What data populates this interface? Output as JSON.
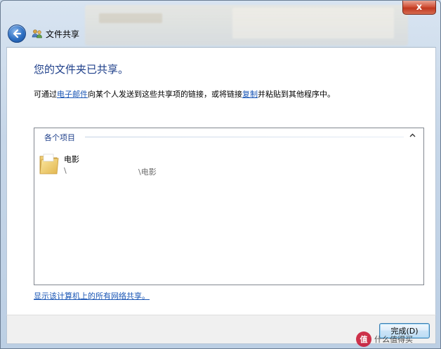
{
  "window": {
    "title": "文件共享",
    "close_glyph": "x"
  },
  "main": {
    "heading": "您的文件夹已共享。",
    "desc_before": "可通过",
    "desc_link_email": "电子邮件",
    "desc_middle": "向某个人发送到这些共享项的链接，或将链接",
    "desc_link_copy": "复制",
    "desc_after": "并粘贴到其他程序中。",
    "group_header": "各个项目",
    "items": [
      {
        "name": "电影",
        "path_prefix": "\\",
        "path_suffix": "\\电影"
      }
    ],
    "show_all_link": "显示该计算机上的所有网络共享。"
  },
  "footer": {
    "finish_label": "完成(D)"
  },
  "watermark": {
    "badge": "值",
    "text": "什么值得买"
  }
}
